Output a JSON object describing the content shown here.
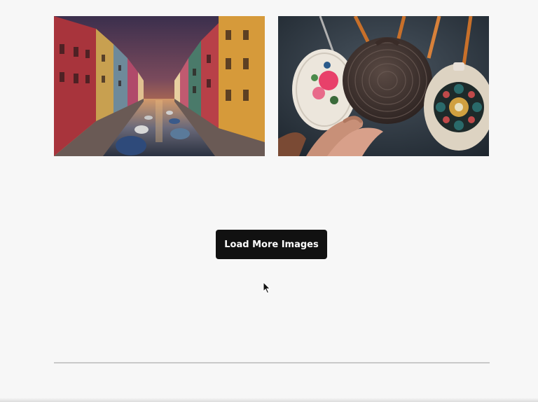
{
  "gallery": {
    "images": [
      {
        "icon": "venice-canal-photo"
      },
      {
        "icon": "woven-round-bags-photo"
      }
    ]
  },
  "load_more": {
    "label": "Load More Images"
  },
  "colors": {
    "background": "#f7f7f7",
    "button_bg": "#111111",
    "button_text": "#ffffff",
    "divider": "#c9c9c9"
  }
}
